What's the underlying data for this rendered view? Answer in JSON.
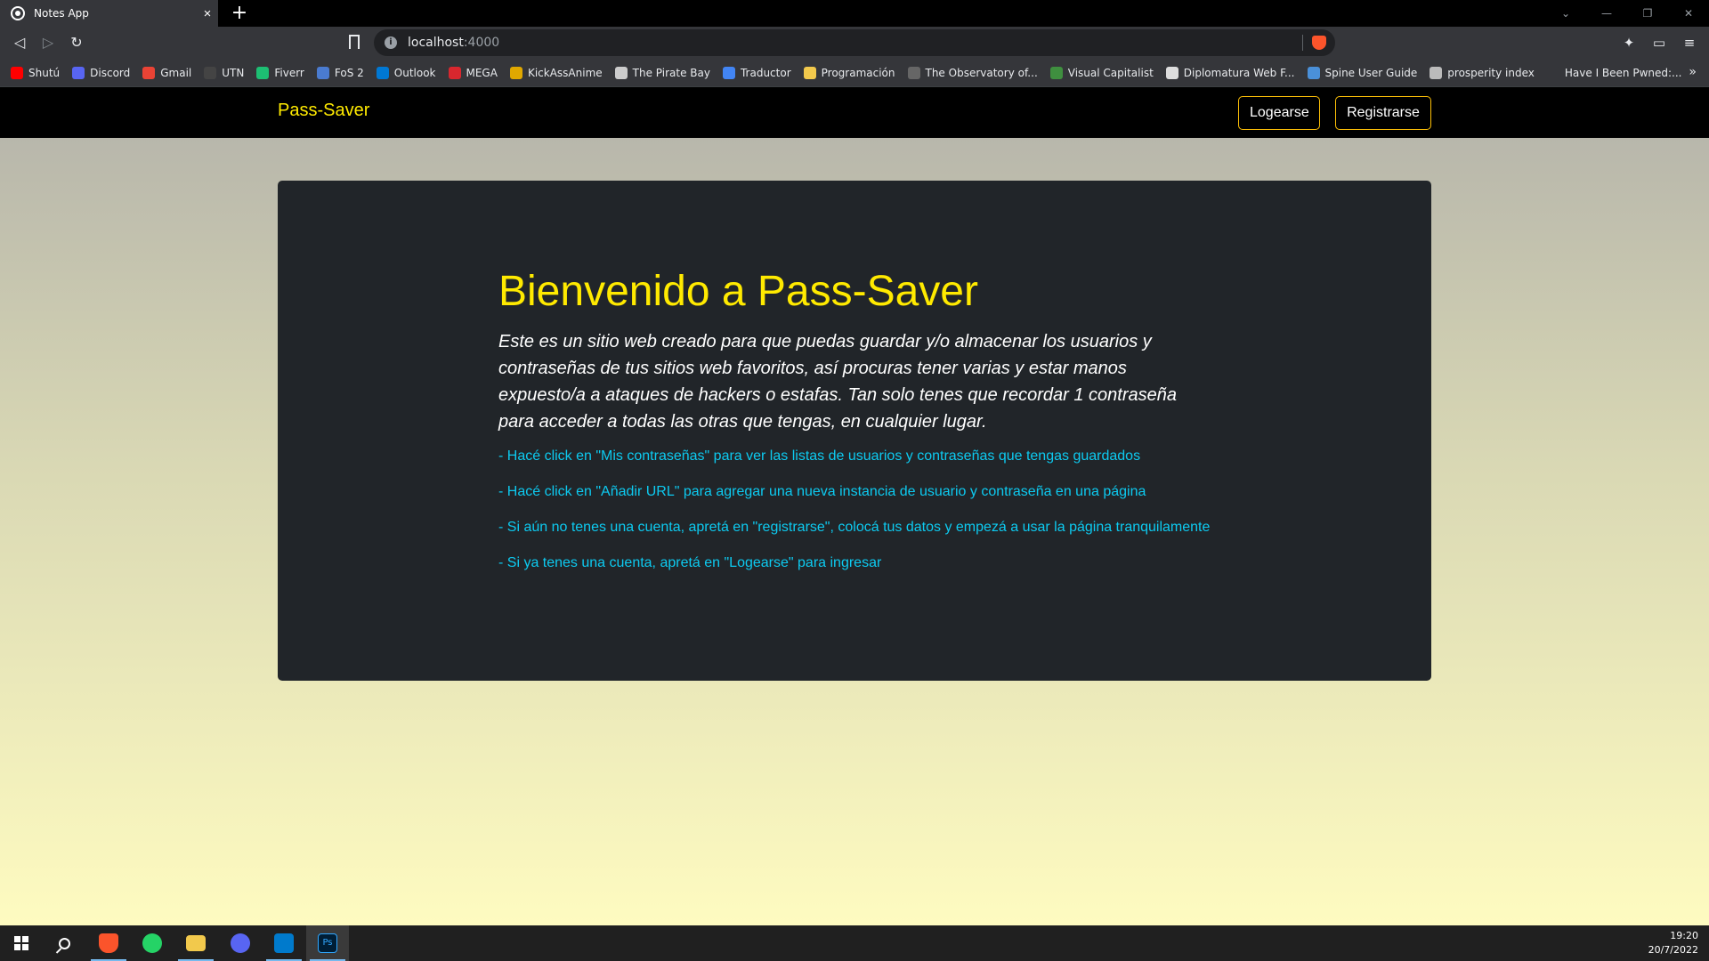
{
  "browser": {
    "tab_title": "Notes App",
    "new_tab": "+",
    "close_tab": "×",
    "url_host": "localhost",
    "url_port": ":4000",
    "bookmarks": [
      {
        "label": "Shutú",
        "color": "#ff0000"
      },
      {
        "label": "Discord",
        "color": "#5865f2"
      },
      {
        "label": "Gmail",
        "color": "#ea4335"
      },
      {
        "label": "UTN",
        "color": "#444444"
      },
      {
        "label": "Fiverr",
        "color": "#1dbf73"
      },
      {
        "label": "FoS 2",
        "color": "#4a7bd0"
      },
      {
        "label": "Outlook",
        "color": "#0078d4"
      },
      {
        "label": "MEGA",
        "color": "#d9272e"
      },
      {
        "label": "KickAssAnime",
        "color": "#e0a800"
      },
      {
        "label": "The Pirate Bay",
        "color": "#cccccc"
      },
      {
        "label": "Traductor",
        "color": "#4285f4"
      },
      {
        "label": "Programación",
        "color": "#f2c94c"
      },
      {
        "label": "The Observatory of...",
        "color": "#666666"
      },
      {
        "label": "Visual Capitalist",
        "color": "#3f8f3f"
      },
      {
        "label": "Diplomatura Web F...",
        "color": "#dddddd"
      },
      {
        "label": "Spine User Guide",
        "color": "#4a90d9"
      },
      {
        "label": "prosperity index",
        "color": "#bbbbbb"
      },
      {
        "label": "Have I Been Pwned:...",
        "color": "#35363a"
      }
    ],
    "more_bookmarks": "»"
  },
  "page": {
    "navbar": {
      "brand": "Pass-Saver",
      "login_label": "Logearse",
      "register_label": "Registrarse"
    },
    "hero": {
      "title": "Bienvenido a Pass-Saver",
      "lead": "Este es un sitio web creado para que puedas guardar y/o almacenar los usuarios y contraseñas de tus sitios web favoritos, así procuras tener varias y estar manos expuesto/a a ataques de hackers o estafas. Tan solo tenes que recordar 1 contraseña para acceder a todas las otras que tengas, en cualquier lugar.",
      "hints": [
        "- Hacé click en \"Mis contraseñas\" para ver las listas de usuarios y contraseñas que tengas guardados",
        "- Hacé click en \"Añadir URL\" para agregar una nueva instancia de usuario y contraseña en una página",
        "- Si aún no tenes una cuenta, apretá en \"registrarse\", colocá tus datos y empezá a usar la página tranquilamente",
        "- Si ya tenes una cuenta, apretá en \"Logearse\" para ingresar"
      ]
    },
    "colors": {
      "brand_yellow": "#ffea00",
      "hint_cyan": "#0dcaf0",
      "card_bg": "#212529",
      "button_border": "#ffc107"
    }
  },
  "taskbar": {
    "apps": [
      "start-icon",
      "search-icon",
      "brave-icon",
      "whatsapp-icon",
      "file-explorer-icon",
      "discord-icon",
      "vscode-icon",
      "photoshop-icon"
    ],
    "time": "19:20",
    "date": "20/7/2022"
  }
}
